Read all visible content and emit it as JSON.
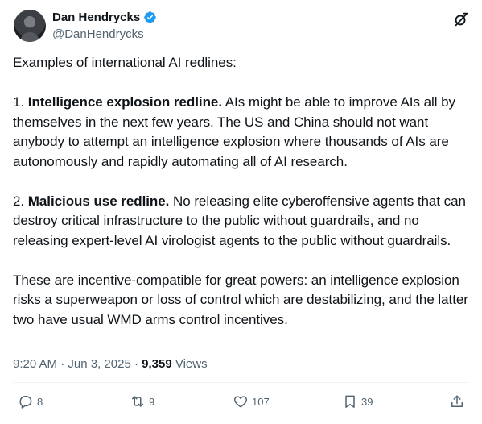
{
  "author": {
    "name": "Dan Hendrycks",
    "handle": "@DanHendrycks"
  },
  "tweet": {
    "intro": "Examples of international AI redlines:",
    "item1_prefix": "1. ",
    "item1_title": "Intelligence explosion redline.",
    "item1_text": " AIs might be able to improve AIs all by themselves in the next few years. The US and China should not want anybody to attempt an intelligence explosion where thousands of AIs are autonomously and rapidly automating all of AI research.",
    "item2_prefix": "2. ",
    "item2_title": "Malicious use redline.",
    "item2_text": " No releasing elite cyberoffensive agents that can destroy critical infrastructure to the public without guardrails, and no releasing expert-level AI virologist agents to the public without guardrails.",
    "closing": "These are incentive-compatible for great powers: an intelligence explosion risks a superweapon or loss of control which are destabilizing, and the latter two have usual WMD arms control incentives."
  },
  "meta": {
    "time": "9:20 AM",
    "sep1": " · ",
    "date": "Jun 3, 2025",
    "sep2": " · ",
    "views_count": "9,359",
    "views_label": " Views"
  },
  "actions": {
    "replies": "8",
    "reposts": "9",
    "likes": "107",
    "bookmarks": "39"
  },
  "colors": {
    "verified": "#1d9bf0",
    "secondary_text": "#536471",
    "primary_text": "#0f1419"
  },
  "icons": [
    "verified-badge-icon",
    "grok-icon",
    "reply-icon",
    "repost-icon",
    "like-icon",
    "bookmark-icon",
    "share-icon"
  ]
}
